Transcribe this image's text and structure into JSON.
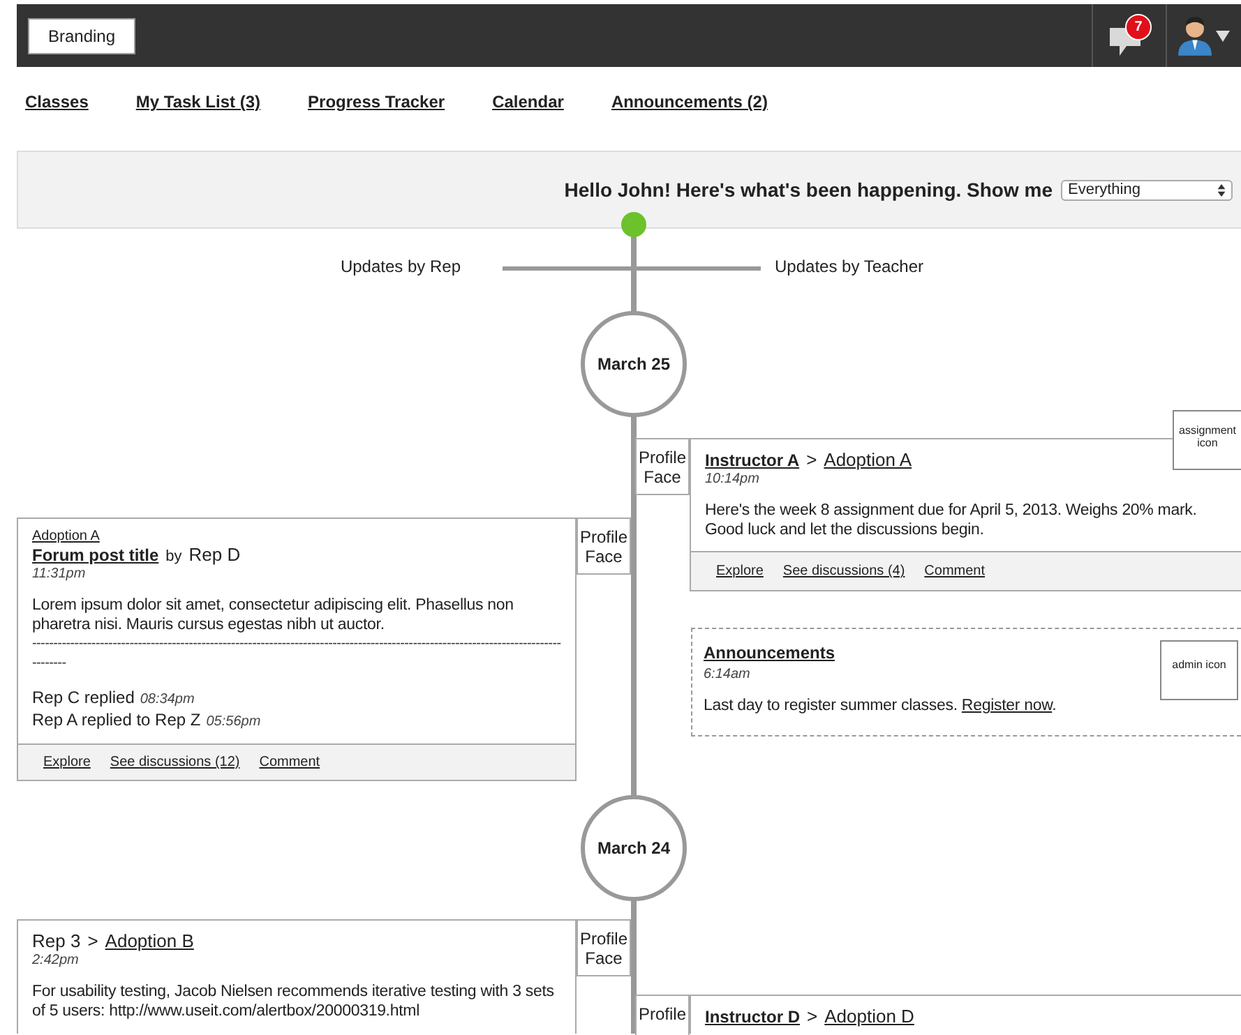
{
  "header": {
    "branding": "Branding",
    "notification_count": "7"
  },
  "nav": [
    "Classes",
    "My Task List (3)",
    "Progress Tracker",
    "Calendar",
    "Announcements (2)"
  ],
  "filter": {
    "greeting": "Hello John! Here's what's been happening. Show me",
    "select": {
      "value": "Everything"
    }
  },
  "lanes": {
    "left": "Updates by Rep",
    "right": "Updates by Teacher"
  },
  "timeline": [
    {
      "kind": "date",
      "date": "March 25"
    },
    {
      "kind": "teacher_post",
      "profile": "Profile Face",
      "head": [
        {
          "text": "Instructor A",
          "kind": "author"
        },
        {
          "text": ">",
          "kind": "text"
        },
        {
          "text": "Adoption A",
          "kind": "link"
        }
      ],
      "time": "10:14pm",
      "body": "Here's the week 8 assignment due for April 5, 2013. Weighs 20% mark. Good luck and let the discussions begin.",
      "badge": "assignment icon",
      "actions": [
        "Explore",
        "See discussions (4)",
        "Comment"
      ]
    },
    {
      "kind": "rep_post",
      "profile": "Profile Face",
      "context": "Adoption A",
      "head": [
        {
          "text": "Forum post title",
          "kind": "author"
        },
        {
          "text": "by",
          "kind": "small"
        },
        {
          "text": "Rep D",
          "kind": "text"
        }
      ],
      "time": "11:31pm",
      "body": "Lorem ipsum dolor sit amet, consectetur adipiscing elit. Phasellus non pharetra nisi. Mauris cursus egestas nibh ut auctor.",
      "separator": "-------------------------------------------------------------------------------------------------------------------------------------",
      "replies": [
        {
          "text": "Rep  C replied",
          "time": "08:34pm"
        },
        {
          "text": "Rep  A replied to   Rep Z",
          "time": "05:56pm"
        }
      ],
      "actions": [
        "Explore",
        "See discussions (12)",
        "Comment"
      ]
    },
    {
      "kind": "announcement",
      "title": "Announcements",
      "time": "6:14am",
      "body": "Last day to register summer classes. ",
      "link": "Register now",
      "tail": ".",
      "badge": "admin icon"
    },
    {
      "kind": "date",
      "date": "March 24"
    },
    {
      "kind": "rep_post",
      "profile": "Profile Face",
      "head": [
        {
          "text": "Rep  3",
          "kind": "text"
        },
        {
          "text": ">",
          "kind": "text"
        },
        {
          "text": "Adoption B",
          "kind": "link"
        }
      ],
      "time": "2:42pm",
      "body": "For usability testing, Jacob Nielsen recommends iterative testing with 3 sets of 5 users: http://www.useit.com/alertbox/20000319.html"
    },
    {
      "kind": "teacher_post",
      "profile": "Profile",
      "head": [
        {
          "text": "Instructor D",
          "kind": "author"
        },
        {
          "text": ">",
          "kind": "text"
        },
        {
          "text": "Adoption D",
          "kind": "link"
        }
      ]
    }
  ]
}
